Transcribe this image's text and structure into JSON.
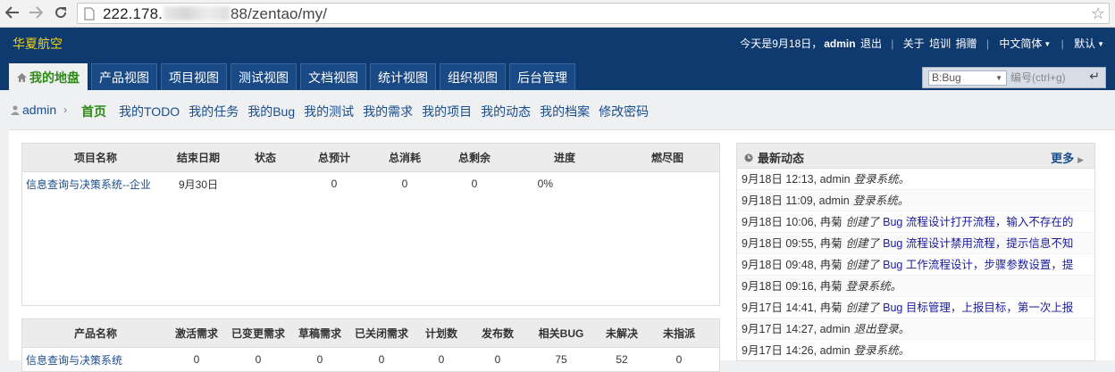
{
  "browser": {
    "url_host": "222.178.",
    "url_rest": "88/zentao/my/"
  },
  "header": {
    "brand": "华夏航空",
    "date_text": "今天是9月18日，",
    "user": "admin",
    "logout": "退出",
    "about": "关于",
    "training": "培训",
    "donate": "捐赠",
    "language": "中文简体",
    "theme": "默认"
  },
  "tabs": [
    "我的地盘",
    "产品视图",
    "项目视图",
    "测试视图",
    "文档视图",
    "统计视图",
    "组织视图",
    "后台管理"
  ],
  "search": {
    "type": "B:Bug",
    "placeholder": "编号(ctrl+g)"
  },
  "subnav": {
    "user": "admin",
    "items": [
      "首页",
      "我的TODO",
      "我的任务",
      "我的Bug",
      "我的测试",
      "我的需求",
      "我的项目",
      "我的动态",
      "我的档案",
      "修改密码"
    ]
  },
  "projects": {
    "headers": [
      "项目名称",
      "结束日期",
      "状态",
      "总预计",
      "总消耗",
      "总剩余",
      "进度",
      "燃尽图"
    ],
    "rows": [
      {
        "name": "信息查询与决策系统--企业",
        "end": "9月30日",
        "status": "",
        "estimate": "0",
        "consumed": "0",
        "left": "0",
        "progress": "0%",
        "burn": ""
      }
    ]
  },
  "products": {
    "headers": [
      "产品名称",
      "激活需求",
      "已变更需求",
      "草稿需求",
      "已关闭需求",
      "计划数",
      "发布数",
      "相关BUG",
      "未解决",
      "未指派"
    ],
    "rows": [
      {
        "name": "信息查询与决策系统",
        "active": "0",
        "changed": "0",
        "draft": "0",
        "closed": "0",
        "plans": "0",
        "releases": "0",
        "bugs": "75",
        "unresolved": "52",
        "unassigned": "0"
      }
    ]
  },
  "dynamic": {
    "title": "最新动态",
    "more": "更多",
    "items": [
      {
        "time": "9月18日 12:13,",
        "user": "admin",
        "action": "登录系统。",
        "obj": ""
      },
      {
        "time": "9月18日 11:09,",
        "user": "admin",
        "action": "登录系统。",
        "obj": ""
      },
      {
        "time": "9月18日 10:06,",
        "user": "冉菊",
        "action": "创建了",
        "obj": "Bug 流程设计打开流程，输入不存在的"
      },
      {
        "time": "9月18日 09:55,",
        "user": "冉菊",
        "action": "创建了",
        "obj": "Bug 流程设计禁用流程，提示信息不知"
      },
      {
        "time": "9月18日 09:48,",
        "user": "冉菊",
        "action": "创建了",
        "obj": "Bug 工作流程设计，步骤参数设置，提"
      },
      {
        "time": "9月18日 09:16,",
        "user": "冉菊",
        "action": "登录系统。",
        "obj": ""
      },
      {
        "time": "9月17日 14:41,",
        "user": "冉菊",
        "action": "创建了",
        "obj": "Bug 目标管理，上报目标，第一次上报"
      },
      {
        "time": "9月17日 14:27,",
        "user": "admin",
        "action": "退出登录。",
        "obj": ""
      },
      {
        "time": "9月17日 14:26,",
        "user": "admin",
        "action": "登录系统。",
        "obj": ""
      }
    ]
  }
}
